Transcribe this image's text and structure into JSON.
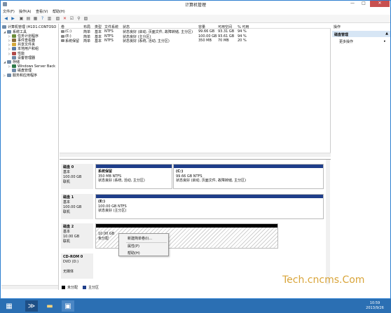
{
  "window": {
    "title": "计算机管理",
    "min": "—",
    "max": "□",
    "close": "✕"
  },
  "menu": [
    "文件(F)",
    "操作(A)",
    "查看(V)",
    "帮助(H)"
  ],
  "toolbar_icons": [
    "back-icon",
    "forward-icon",
    "up-icon",
    "show-hide-tree-icon",
    "properties-icon",
    "help-icon",
    "refresh-icon",
    "export-icon",
    "connect-icon",
    "settings-icon",
    "search-icon",
    "properties2-icon"
  ],
  "tree": {
    "root": "计算机管理 (H1D1.CONTOSO",
    "items": [
      {
        "label": "系统工具",
        "level": 1,
        "arrow": "◢"
      },
      {
        "label": "任务计划程序",
        "level": 2,
        "arrow": "▷"
      },
      {
        "label": "事件查看器",
        "level": 2,
        "arrow": "▷"
      },
      {
        "label": "共享文件夹",
        "level": 2,
        "arrow": "▷"
      },
      {
        "label": "本地用户和组",
        "level": 2,
        "arrow": "▷"
      },
      {
        "label": "性能",
        "level": 2,
        "arrow": "▷"
      },
      {
        "label": "设备管理器",
        "level": 2,
        "arrow": ""
      },
      {
        "label": "存储",
        "level": 1,
        "arrow": "◢"
      },
      {
        "label": "Windows Server Back",
        "level": 2,
        "arrow": "▷"
      },
      {
        "label": "磁盘管理",
        "level": 2,
        "arrow": ""
      },
      {
        "label": "服务和应用程序",
        "level": 1,
        "arrow": "▷"
      }
    ]
  },
  "volume_table": {
    "headers": [
      "卷",
      "布局",
      "类型",
      "文件系统",
      "状态",
      "容量",
      "可用空间",
      "% 可用"
    ],
    "rows": [
      [
        "(C:)",
        "简单",
        "基本",
        "NTFS",
        "状态良好 (启动, 页面文件, 故障转储, 主分区)",
        "99.66 GB",
        "93.31 GB",
        "94 %"
      ],
      [
        "(E:)",
        "简单",
        "基本",
        "NTFS",
        "状态良好 (主分区)",
        "100.00 GB",
        "93.61 GB",
        "94 %"
      ],
      [
        "系统保留",
        "简单",
        "基本",
        "NTFS",
        "状态良好 (系统, 活动, 主分区)",
        "350 MB",
        "70 MB",
        "20 %"
      ]
    ]
  },
  "disks": [
    {
      "name": "磁盘 0",
      "type": "基本",
      "size": "100.00 GB",
      "status": "联机",
      "parts": [
        {
          "title": "系统保留",
          "size": "350 MB NTFS",
          "status": "状态良好 (系统, 活动, 主分区)"
        },
        {
          "title": "(C:)",
          "size": "99.66 GB NTFS",
          "status": "状态良好 (启动, 页面文件, 故障转储, 主分区)"
        }
      ]
    },
    {
      "name": "磁盘 1",
      "type": "基本",
      "size": "100.00 GB",
      "status": "联机",
      "parts": [
        {
          "title": "(E:)",
          "size": "100.00 GB NTFS",
          "status": "状态良好 (主分区)"
        }
      ]
    },
    {
      "name": "磁盘 2",
      "type": "基本",
      "size": "10.00 GB",
      "status": "联机",
      "parts": [
        {
          "title": "",
          "size": "10.00 GB",
          "status": "未分配"
        }
      ]
    },
    {
      "name": "CD-ROM 0",
      "type": "DVD (D:)",
      "size": "",
      "status": "无媒体",
      "parts": []
    }
  ],
  "legend": [
    "未分配",
    "主分区"
  ],
  "colors": {
    "primary": "#1f3e8a",
    "unallocated": "#000000",
    "accent": "#2b6fb3"
  },
  "context_menu": [
    "新建简单卷(I)...",
    "属性(P)",
    "帮助(H)"
  ],
  "ops": {
    "header": "操作",
    "section": "磁盘管理",
    "more": "更多操作"
  },
  "taskbar": {
    "time": "10:59",
    "date": "2013/9/26"
  },
  "watermark": "Tech.cncms.Com"
}
